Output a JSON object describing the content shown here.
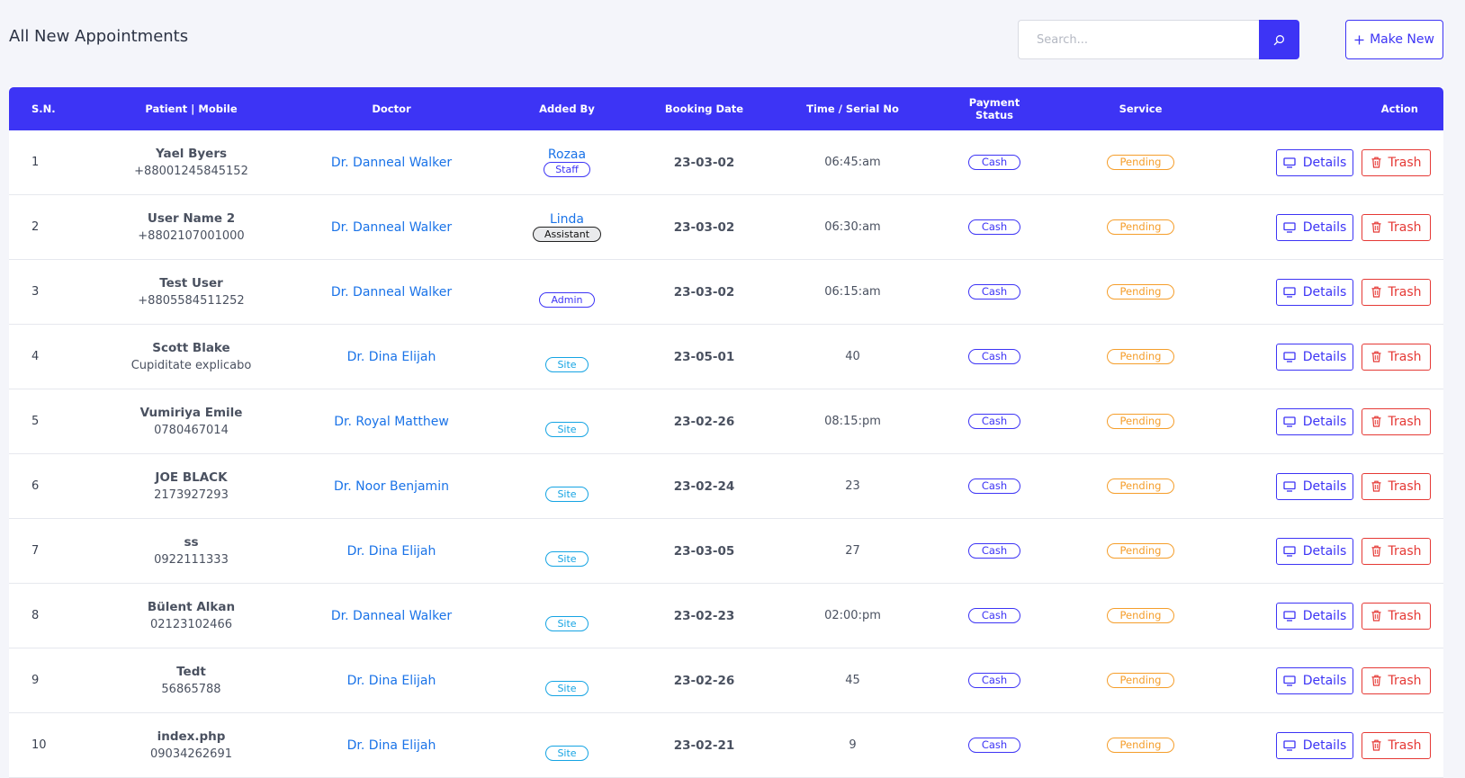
{
  "header": {
    "title": "All New Appointments",
    "search_placeholder": "Search...",
    "make_new_label": "Make New"
  },
  "table": {
    "columns": {
      "sn": "S.N.",
      "patient": "Patient | Mobile",
      "doctor": "Doctor",
      "added_by": "Added By",
      "booking_date": "Booking Date",
      "time_serial": "Time / Serial No",
      "payment_status": "Payment Status",
      "service": "Service",
      "action": "Action"
    },
    "details_label": "Details",
    "trash_label": "Trash",
    "rows": [
      {
        "sn": "1",
        "name": "Yael Byers",
        "mobile": "+88001245845152",
        "doctor": "Dr. Danneal Walker",
        "adder": "Rozaa",
        "role": "Staff",
        "role_type": "staff",
        "date": "23-03-02",
        "time": "06:45:am",
        "payment": "Cash",
        "service": "Pending"
      },
      {
        "sn": "2",
        "name": "User Name 2",
        "mobile": "+8802107001000",
        "doctor": "Dr. Danneal Walker",
        "adder": "Linda",
        "role": "Assistant",
        "role_type": "assistant",
        "date": "23-03-02",
        "time": "06:30:am",
        "payment": "Cash",
        "service": "Pending"
      },
      {
        "sn": "3",
        "name": "Test User",
        "mobile": "+8805584511252",
        "doctor": "Dr. Danneal Walker",
        "adder": "",
        "role": "Admin",
        "role_type": "admin",
        "date": "23-03-02",
        "time": "06:15:am",
        "payment": "Cash",
        "service": "Pending"
      },
      {
        "sn": "4",
        "name": "Scott Blake",
        "mobile": "Cupiditate explicabo",
        "doctor": "Dr. Dina Elijah",
        "adder": "",
        "role": "Site",
        "role_type": "site",
        "date": "23-05-01",
        "time": "40",
        "payment": "Cash",
        "service": "Pending"
      },
      {
        "sn": "5",
        "name": "Vumiriya Emile",
        "mobile": "0780467014",
        "doctor": "Dr. Royal Matthew",
        "adder": "",
        "role": "Site",
        "role_type": "site",
        "date": "23-02-26",
        "time": "08:15:pm",
        "payment": "Cash",
        "service": "Pending"
      },
      {
        "sn": "6",
        "name": "JOE BLACK",
        "mobile": "2173927293",
        "doctor": "Dr. Noor Benjamin",
        "adder": "",
        "role": "Site",
        "role_type": "site",
        "date": "23-02-24",
        "time": "23",
        "payment": "Cash",
        "service": "Pending"
      },
      {
        "sn": "7",
        "name": "ss",
        "mobile": "0922111333",
        "doctor": "Dr. Dina Elijah",
        "adder": "",
        "role": "Site",
        "role_type": "site",
        "date": "23-03-05",
        "time": "27",
        "payment": "Cash",
        "service": "Pending"
      },
      {
        "sn": "8",
        "name": "Bülent Alkan",
        "mobile": "02123102466",
        "doctor": "Dr. Danneal Walker",
        "adder": "",
        "role": "Site",
        "role_type": "site",
        "date": "23-02-23",
        "time": "02:00:pm",
        "payment": "Cash",
        "service": "Pending"
      },
      {
        "sn": "9",
        "name": "Tedt",
        "mobile": "56865788",
        "doctor": "Dr. Dina Elijah",
        "adder": "",
        "role": "Site",
        "role_type": "site",
        "date": "23-02-26",
        "time": "45",
        "payment": "Cash",
        "service": "Pending"
      },
      {
        "sn": "10",
        "name": "index.php",
        "mobile": "09034262691",
        "doctor": "Dr. Dina Elijah",
        "adder": "",
        "role": "Site",
        "role_type": "site",
        "date": "23-02-21",
        "time": "9",
        "payment": "Cash",
        "service": "Pending"
      }
    ]
  },
  "icons": {
    "search": "search-icon",
    "plus": "plus-icon",
    "details": "monitor-icon",
    "trash": "trash-icon"
  },
  "colors": {
    "primary": "#3d34f5",
    "link": "#1a73e8",
    "danger": "#e53935",
    "pending": "#f59e2b",
    "site": "#15a4e3"
  }
}
